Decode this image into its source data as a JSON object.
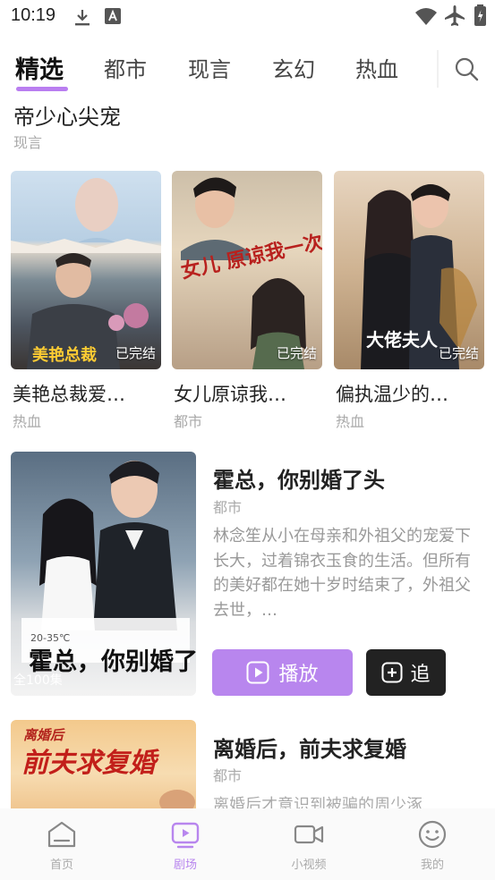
{
  "status_bar": {
    "time": "10:19"
  },
  "tabs": [
    {
      "label": "精选",
      "active": true
    },
    {
      "label": "都市"
    },
    {
      "label": "现言"
    },
    {
      "label": "玄幻"
    },
    {
      "label": "热血"
    }
  ],
  "partial_item": {
    "title": "帝少心尖宠",
    "genre": "现言"
  },
  "grid": [
    {
      "title": "美艳总裁爱…",
      "genre": "热血",
      "badge": "已完结",
      "poster_text": "美艳总裁"
    },
    {
      "title": "女儿原谅我…",
      "genre": "都市",
      "badge": "已完结",
      "poster_text": "女儿 原谅我一次"
    },
    {
      "title": "偏执温少的…",
      "genre": "热血",
      "badge": "已完结",
      "poster_text": "大佬夫人"
    }
  ],
  "feature": {
    "title": "霍总，你别婚了头",
    "genre": "都市",
    "description": "林念笙从小在母亲和外祖父的宠爱下长大，过着锦衣玉食的生活。但所有的美好都在她十岁时结束了，外祖父去世，…",
    "play_label": "播放",
    "follow_label": "追",
    "poster_text": "霍总，你别婚了头",
    "poster_episodes": "全100集",
    "poster_temp": "20-35℃"
  },
  "feature2": {
    "title": "离婚后，前夫求复婚",
    "genre": "都市",
    "description": "离婚后才意识到被骗的周少涿",
    "poster_text": "前夫求复婚",
    "poster_top": "离婚后"
  },
  "bottom_nav": [
    {
      "label": "首页",
      "icon": "home-icon"
    },
    {
      "label": "剧场",
      "icon": "theater-icon",
      "active": true
    },
    {
      "label": "小视频",
      "icon": "video-camera-icon"
    },
    {
      "label": "我的",
      "icon": "smile-face-icon"
    }
  ],
  "colors": {
    "accent": "#b886ee",
    "dark_button": "#222222"
  }
}
